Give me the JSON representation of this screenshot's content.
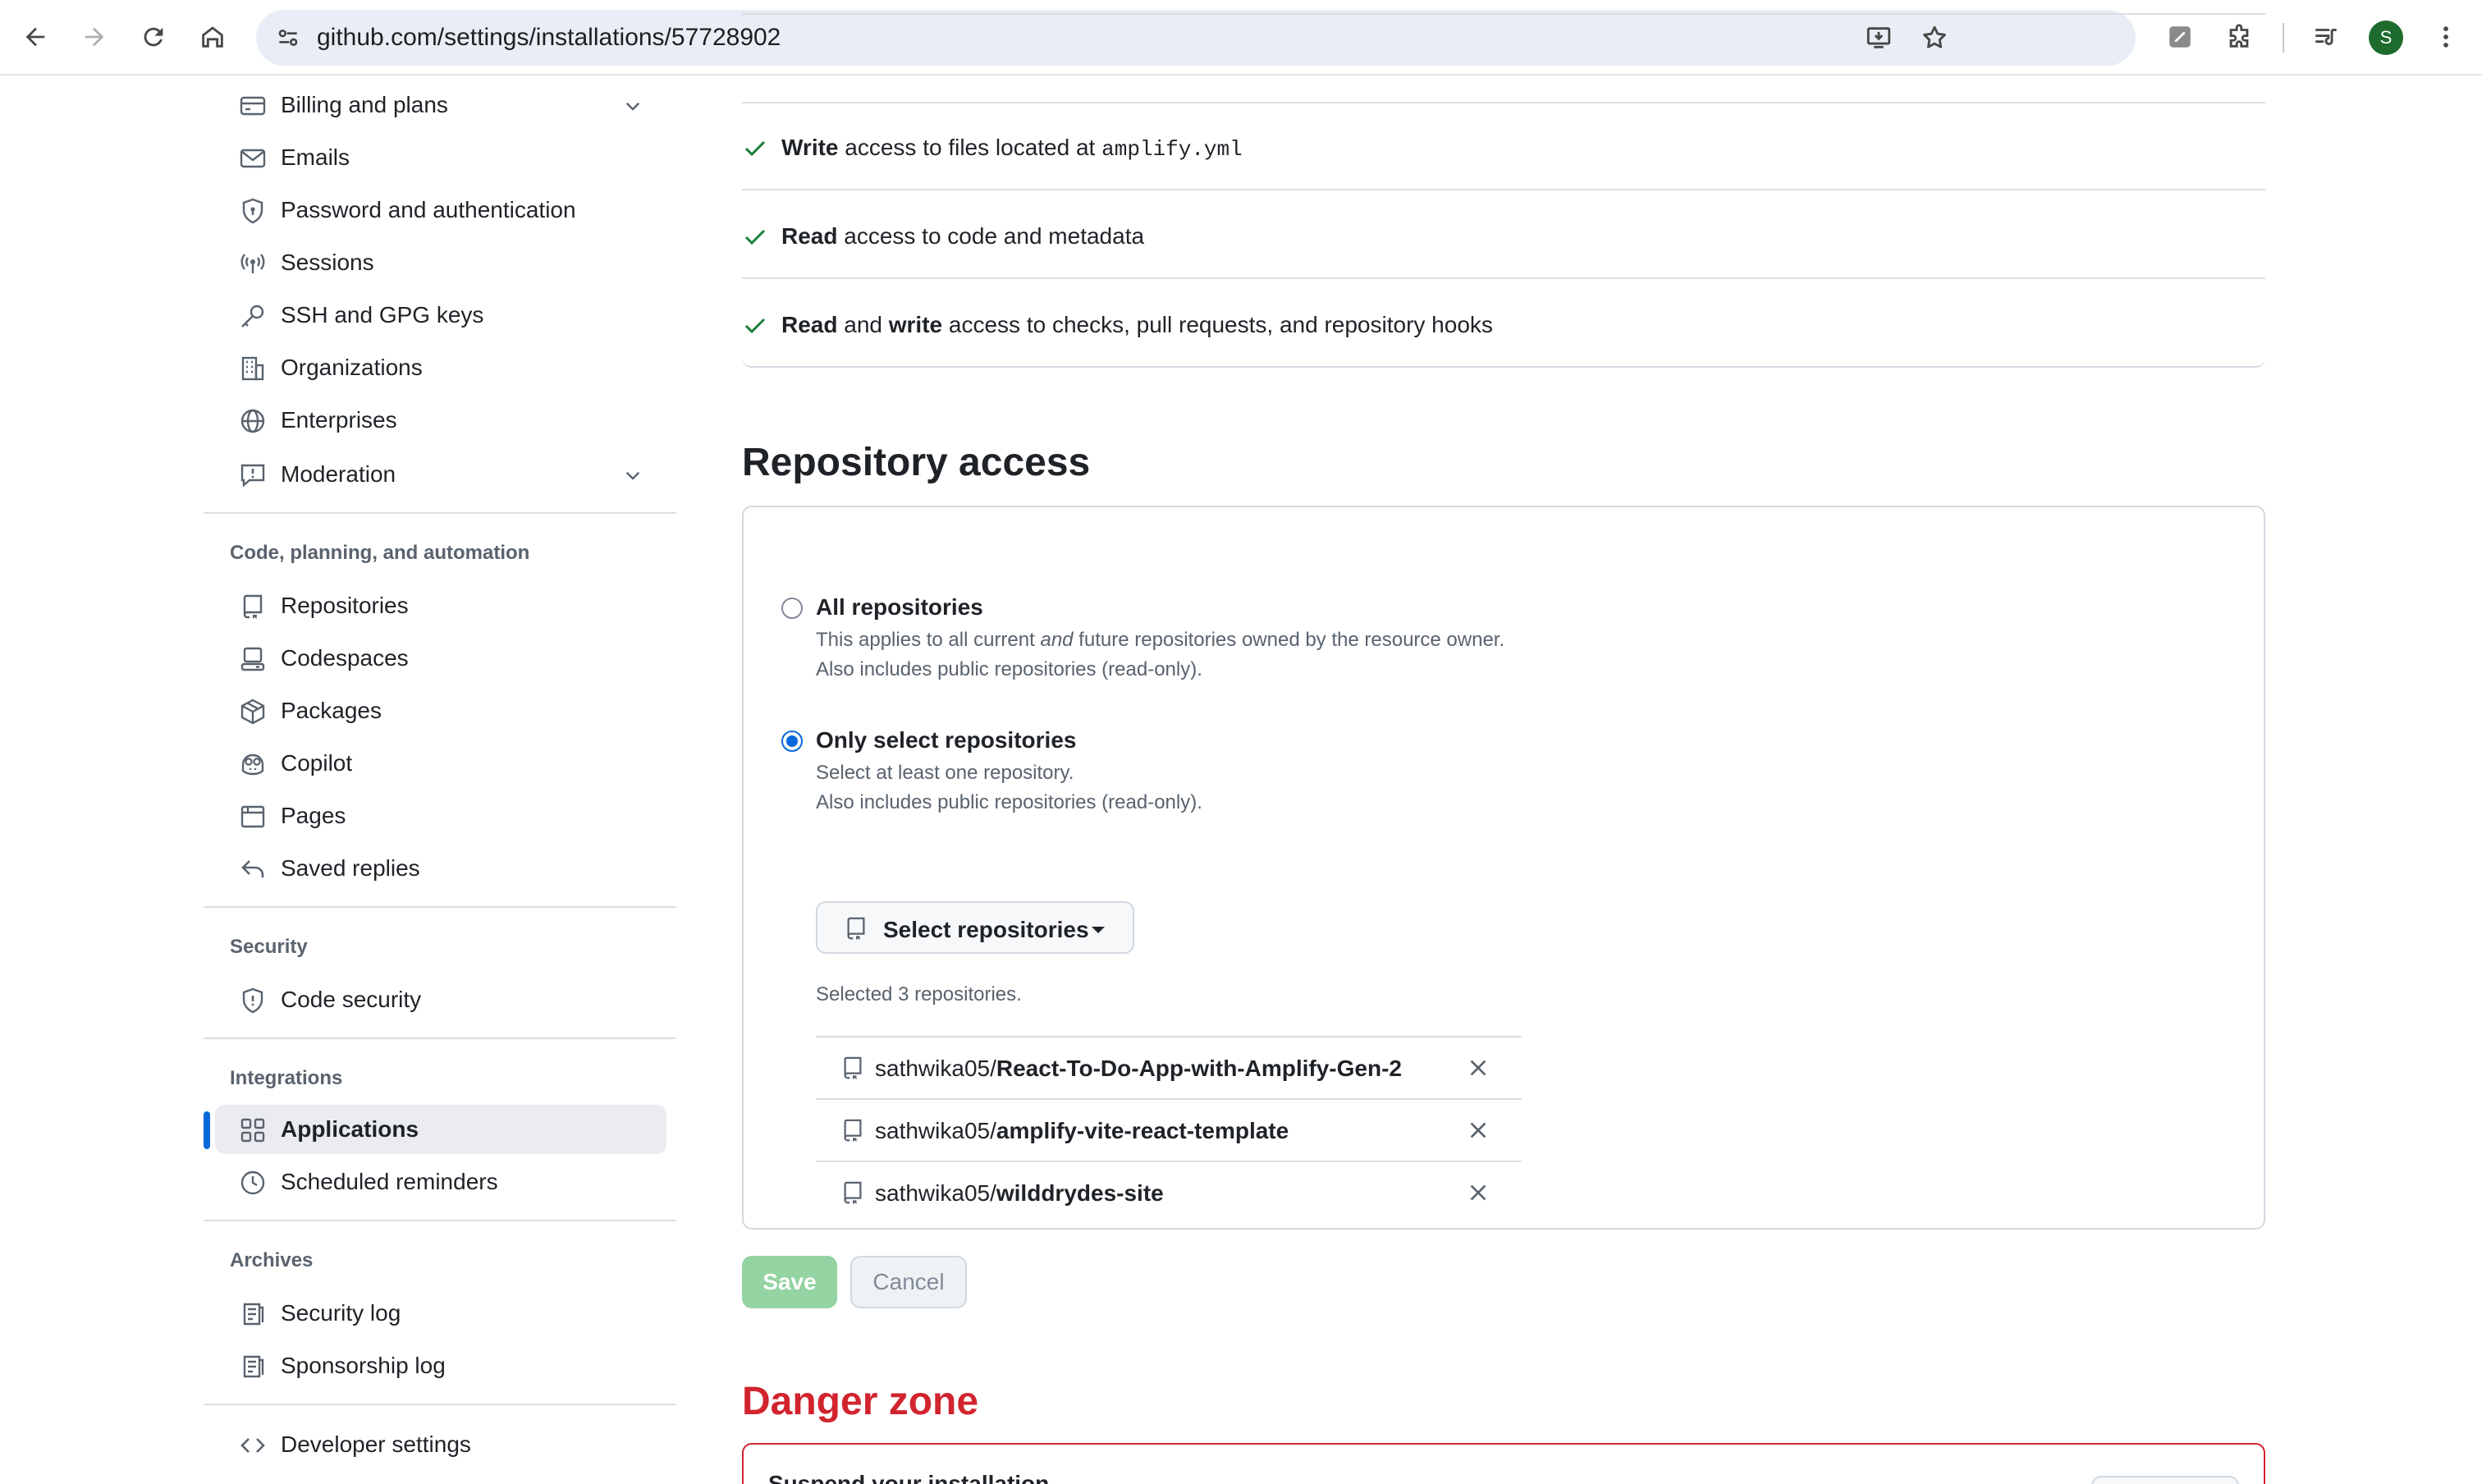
{
  "browser": {
    "url": "github.com/settings/installations/57728902",
    "avatar_letter": "S"
  },
  "sidebar": {
    "top_items": [
      {
        "label": "Billing and plans",
        "icon": "credit-card-icon",
        "expandable": true
      },
      {
        "label": "Emails",
        "icon": "mail-icon"
      },
      {
        "label": "Password and authentication",
        "icon": "shield-lock-icon"
      },
      {
        "label": "Sessions",
        "icon": "broadcast-icon"
      },
      {
        "label": "SSH and GPG keys",
        "icon": "key-icon"
      },
      {
        "label": "Organizations",
        "icon": "organization-icon"
      },
      {
        "label": "Enterprises",
        "icon": "globe-icon"
      },
      {
        "label": "Moderation",
        "icon": "report-icon",
        "expandable": true
      }
    ],
    "section_code": {
      "heading": "Code, planning, and automation",
      "items": [
        {
          "label": "Repositories",
          "icon": "repo-icon"
        },
        {
          "label": "Codespaces",
          "icon": "codespaces-icon"
        },
        {
          "label": "Packages",
          "icon": "package-icon"
        },
        {
          "label": "Copilot",
          "icon": "copilot-icon"
        },
        {
          "label": "Pages",
          "icon": "browser-icon"
        },
        {
          "label": "Saved replies",
          "icon": "reply-icon"
        }
      ]
    },
    "section_security": {
      "heading": "Security",
      "items": [
        {
          "label": "Code security",
          "icon": "shield-icon"
        }
      ]
    },
    "section_integrations": {
      "heading": "Integrations",
      "items": [
        {
          "label": "Applications",
          "icon": "apps-icon",
          "active": true
        },
        {
          "label": "Scheduled reminders",
          "icon": "clock-icon"
        }
      ]
    },
    "section_archives": {
      "heading": "Archives",
      "items": [
        {
          "label": "Security log",
          "icon": "log-icon"
        },
        {
          "label": "Sponsorship log",
          "icon": "log-icon"
        }
      ]
    },
    "developer_settings": {
      "label": "Developer settings",
      "icon": "code-icon"
    }
  },
  "permissions": {
    "row1": {
      "bold1": "Write",
      "text": " access to files located at ",
      "code": "amplify.yml"
    },
    "row2": {
      "bold1": "Read",
      "text": " access to code and metadata"
    },
    "row3": {
      "bold1": "Read",
      "mid": " and ",
      "bold2": "write",
      "text": " access to checks, pull requests, and repository hooks"
    }
  },
  "repository_access": {
    "heading": "Repository access",
    "all": {
      "title": "All repositories",
      "desc_before": "This applies to all current ",
      "desc_em": "and",
      "desc_after": " future repositories owned by the resource owner.",
      "desc_line2": "Also includes public repositories (read-only).",
      "checked": false
    },
    "select": {
      "title": "Only select repositories",
      "desc_line1": "Select at least one repository.",
      "desc_line2": "Also includes public repositories (read-only).",
      "checked": true
    },
    "select_button_label": "Select repositories",
    "selected_count_text": "Selected 3 repositories.",
    "repos": [
      {
        "owner": "sathwika05/",
        "name": "React-To-Do-App-with-Amplify-Gen-2"
      },
      {
        "owner": "sathwika05/",
        "name": "amplify-vite-react-template"
      },
      {
        "owner": "sathwika05/",
        "name": "wilddrydes-site"
      }
    ]
  },
  "actions": {
    "save_label": "Save",
    "cancel_label": "Cancel"
  },
  "danger_zone": {
    "heading": "Danger zone",
    "row_title": "Suspend your installation"
  }
}
